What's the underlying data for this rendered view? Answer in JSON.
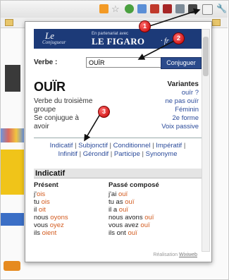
{
  "banner": {
    "brand_line1": "Le",
    "brand_line2": "Conjugueur",
    "partner": "En partenariat avec",
    "figaro": "LE FIGARO",
    "figaro_suffix": "· fr"
  },
  "form": {
    "label": "Verbe :",
    "value": "OUÏR",
    "button": "Conjuguer"
  },
  "verb": {
    "title": "OUÏR",
    "description": "Verbe du troisième groupe Se conjugue avoir",
    "desc_line1": "Verbe du troisième",
    "desc_line2": "groupe",
    "desc_line3": "Se conjugue à",
    "desc_line4": "avoir"
  },
  "variantes": {
    "title": "Variantes",
    "items": [
      "ouïr ?",
      "ne pas ouïr",
      "Féminin",
      "2e forme",
      "Voix passive"
    ]
  },
  "nav": {
    "items": [
      "Indicatif",
      "Subjonctif",
      "Conditionnel",
      "Impératif",
      "Infinitif",
      "Gérondif",
      "Participe",
      "Synonyme"
    ]
  },
  "section": {
    "title": "Indicatif"
  },
  "present": {
    "title": "Présent",
    "rows": [
      {
        "p": "j'",
        "e": "ois"
      },
      {
        "p": "tu ",
        "e": "ois"
      },
      {
        "p": "il ",
        "e": "oit"
      },
      {
        "p": "nous ",
        "e": "oyons"
      },
      {
        "p": "vous ",
        "e": "oyez"
      },
      {
        "p": "ils ",
        "e": "oient"
      }
    ]
  },
  "passe": {
    "title": "Passé composé",
    "rows": [
      {
        "p": "j'ai ",
        "e": "ouï"
      },
      {
        "p": "tu as ",
        "e": "ouï"
      },
      {
        "p": "il a ",
        "e": "ouï"
      },
      {
        "p": "nous avons ",
        "e": "ouï"
      },
      {
        "p": "vous avez ",
        "e": "ouï"
      },
      {
        "p": "ils ont ",
        "e": "ouï"
      }
    ]
  },
  "footer": {
    "label": "Réalisation",
    "link": "Wixiweb"
  },
  "callouts": [
    "1",
    "2",
    "3"
  ],
  "colors": {
    "accent": "#2a4a8b",
    "ending": "#d25a1e",
    "callout": "#d00000"
  }
}
